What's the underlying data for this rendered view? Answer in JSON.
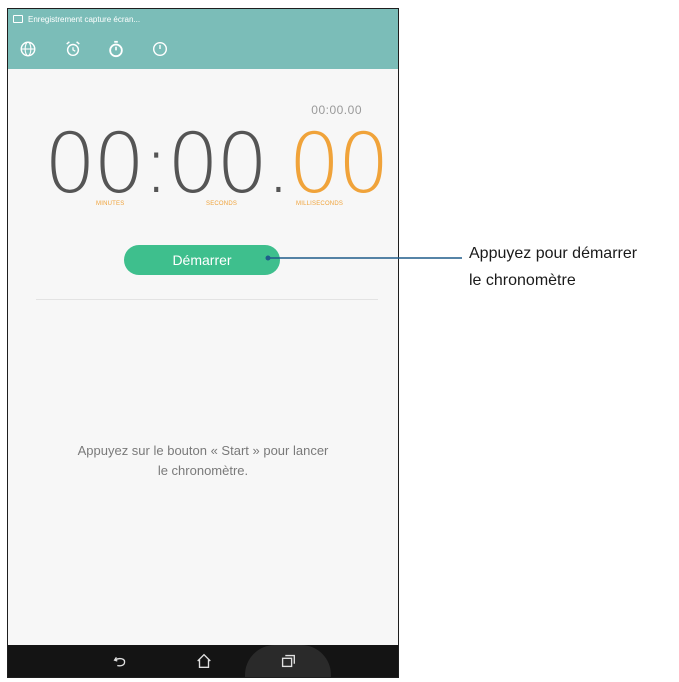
{
  "status_bar": {
    "notification": "Enregistrement capture écran..."
  },
  "tabs": [
    {
      "name": "world-clock",
      "icon": "globe-icon"
    },
    {
      "name": "alarm",
      "icon": "alarm-icon"
    },
    {
      "name": "stopwatch",
      "icon": "stopwatch-icon",
      "active": true
    },
    {
      "name": "timer",
      "icon": "timer-icon"
    }
  ],
  "stopwatch": {
    "lap_time": "00:00.00",
    "minutes": "00",
    "seconds": "00",
    "milliseconds": "00",
    "unit_minutes": "MINUTES",
    "unit_seconds": "SECONDS",
    "unit_milliseconds": "MILLISECONDS",
    "start_label": "Démarrer",
    "hint_line1": "Appuyez sur le bouton « Start » pour lancer",
    "hint_line2": "le chronomètre."
  },
  "nav": [
    {
      "name": "back",
      "icon": "back-icon"
    },
    {
      "name": "home",
      "icon": "home-icon"
    },
    {
      "name": "recents",
      "icon": "recents-icon"
    }
  ],
  "callout": {
    "line1": "Appuyez pour démarrer",
    "line2": "le chronomètre"
  },
  "colors": {
    "header": "#7bbdb8",
    "accent_orange": "#f0a33a",
    "button_green": "#3ebf8d",
    "callout_line": "#1f5c8a"
  }
}
